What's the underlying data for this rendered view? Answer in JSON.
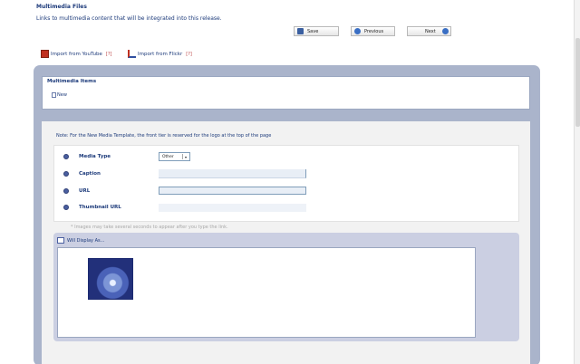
{
  "header": {
    "title": "Multimedia Files",
    "description": "Links to multimedia content that will be integrated into this release."
  },
  "toolbar": {
    "save_label": "Save",
    "previous_label": "Previous",
    "next_label": "Next"
  },
  "imports": {
    "youtube_label": "Import from YouTube",
    "flickr_label": "Import from Flickr",
    "help_mark": "[?]"
  },
  "multimedia_items": {
    "title": "Multimedia Items",
    "new_label": "New"
  },
  "form": {
    "note": "Note: For the New Media Template, the front tier is reserved for the logo at the top of the page",
    "media_type_label": "Media Type",
    "media_type_value": "Other",
    "caption_label": "Caption",
    "url_label": "URL",
    "thumbnail_label": "Thumbnail URL",
    "hint": "* Images may take several seconds to appear after you type the link."
  },
  "preview": {
    "heading": "Will Display As..."
  },
  "colors": {
    "accent": "#1c3a7a",
    "panel": "#aab4cb",
    "preview_panel": "#cbcfe2"
  }
}
